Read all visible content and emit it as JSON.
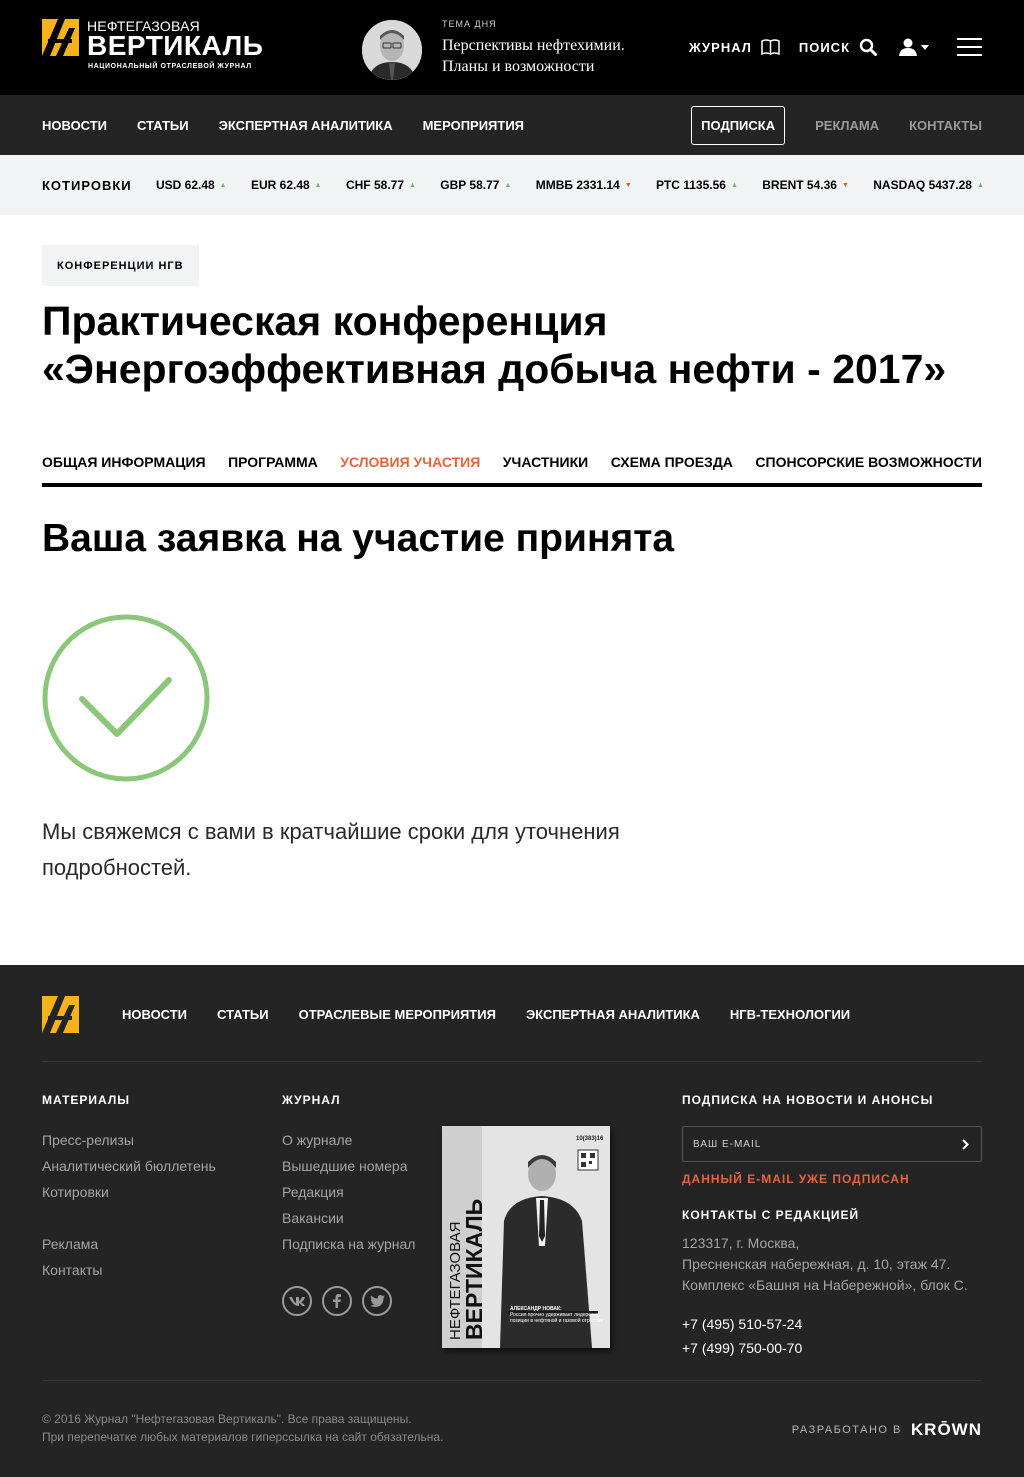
{
  "header": {
    "logo": {
      "top": "НЕФТЕГАЗОВАЯ",
      "main": "ВЕРТИКАЛЬ",
      "sub": "НАЦИОНАЛЬНЫЙ ОТРАСЛЕВОЙ ЖУРНАЛ"
    },
    "topic_label": "ТЕМА ДНЯ",
    "topic_text": "Перспективы нефтехимии. Планы и возможности",
    "journal_label": "ЖУРНАЛ",
    "search_label": "ПОИСК"
  },
  "nav": {
    "items": [
      "НОВОСТИ",
      "СТАТЬИ",
      "ЭКСПЕРТНАЯ АНАЛИТИКА",
      "МЕРОПРИЯТИЯ"
    ],
    "subscribe": "ПОДПИСКА",
    "ads": "РЕКЛАМА",
    "contacts": "КОНТАКТЫ"
  },
  "quotes": {
    "title": "КОТИРОВКИ",
    "items": [
      {
        "label": "USD 62.48",
        "trend": "up"
      },
      {
        "label": "EUR 62.48",
        "trend": "up"
      },
      {
        "label": "CHF 58.77",
        "trend": "up"
      },
      {
        "label": "GBP 58.77",
        "trend": "up"
      },
      {
        "label": "ММВБ 2331.14",
        "trend": "down"
      },
      {
        "label": "РТС 1135.56",
        "trend": "up"
      },
      {
        "label": "BRENT 54.36",
        "trend": "down"
      },
      {
        "label": "NASDAQ 5437.28",
        "trend": "up"
      }
    ]
  },
  "page": {
    "tag": "КОНФЕРЕНЦИИ НГВ",
    "title_line1": "Практическая конференция",
    "title_line2": "«Энергоэффективная добыча нефти - 2017»",
    "tabs": [
      "ОБЩАЯ ИНФОРМАЦИЯ",
      "ПРОГРАММА",
      "УСЛОВИЯ УЧАСТИЯ",
      "УЧАСТНИКИ",
      "СХЕМА ПРОЕЗДА",
      "СПОНСОРСКИЕ ВОЗМОЖНОСТИ"
    ],
    "active_tab": "УСЛОВИЯ УЧАСТИЯ",
    "heading": "Ваша заявка на участие принята",
    "notice_line1": "Мы свяжемся с вами в кратчайшие сроки для уточнения",
    "notice_line2": "подробностей."
  },
  "footer": {
    "nav": [
      "НОВОСТИ",
      "СТАТЬИ",
      "ОТРАСЛЕВЫЕ МЕРОПРИЯТИЯ",
      "ЭКСПЕРТНАЯ АНАЛИТИКА",
      "НГВ-ТЕХНОЛОГИИ"
    ],
    "materials_title": "МАТЕРИАЛЫ",
    "materials": [
      "Пресс-релизы",
      "Аналитический бюллетень",
      "Котировки"
    ],
    "materials2": [
      "Реклама",
      "Контакты"
    ],
    "journal_title": "ЖУРНАЛ",
    "journal": [
      "О журнале",
      "Вышедшие номера",
      "Редакция",
      "Вакансии",
      "Подписка на журнал"
    ],
    "socials": [
      "vk-icon",
      "facebook-icon",
      "twitter-icon"
    ],
    "cover": {
      "issue": "10(383)16",
      "brand_top": "НЕФТЕГАЗОВАЯ",
      "brand_main": "ВЕРТИКАЛЬ",
      "person": "АЛЕКСАНДР НОВАК:",
      "caption": "Россия прочно удерживает лидерские позиции в нефтяной и газовой отраслях"
    },
    "subscribe_title": "ПОДПИСКА НА НОВОСТИ И АНОНСЫ",
    "email_placeholder": "ВАШ E-MAIL",
    "email_status": "ДАННЫЙ E-MAIL УЖЕ ПОДПИСАН",
    "contacts_title": "КОНТАКТЫ С РЕДАКЦИЕЙ",
    "address": [
      "123317, г. Москва,",
      "Пресненская набережная, д. 10, этаж 47.",
      "Комплекс «Башня на Набережной», блок С."
    ],
    "phones": [
      "+7 (495) 510-57-24",
      "+7 (499) 750-00-70"
    ],
    "copyright_line1": "© 2016 Журнал \"Нефтегазовая Вертикаль\". Все права защищены.",
    "copyright_line2": "При перепечатке любых материалов гиперссылка на сайт обязательна.",
    "dev_label": "РАЗРАБОТАНО В",
    "dev_brand": "KRŌWN"
  },
  "colors": {
    "accent": "#e8633a",
    "brand_yellow": "#f5b21a",
    "success": "#8bc77a",
    "trend_up": "#6bbf6f",
    "trend_down": "#e05a2b"
  }
}
